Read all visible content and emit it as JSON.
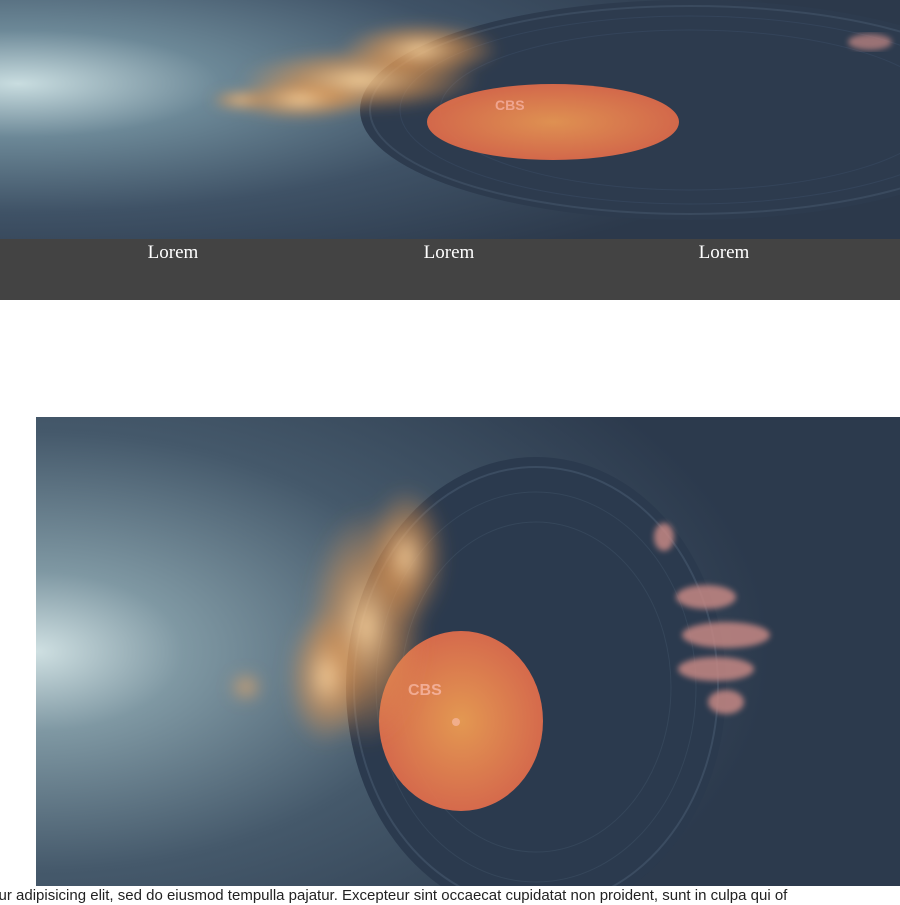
{
  "hero": {
    "image": "vinyl-record-on-fire",
    "label_text": "CBS"
  },
  "nav": {
    "items": [
      {
        "label": "Lorem"
      },
      {
        "label": "Lorem"
      },
      {
        "label": "Lorem"
      }
    ]
  },
  "feature": {
    "image": "hand-holding-burning-vinyl-record",
    "label_text": "CBS"
  },
  "body": {
    "text": "ectetur adipisicing elit, sed do eiusmod tempulla pajatur. Excepteur sint occaecat cupidatat non proident, sunt in culpa qui of"
  },
  "colors": {
    "nav_bg": "#434343",
    "nav_text": "#ffffff",
    "record_label": "#e8864a"
  }
}
